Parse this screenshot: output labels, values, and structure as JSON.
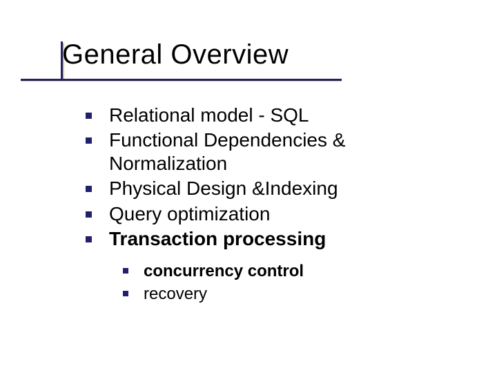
{
  "title": "General Overview",
  "bullets": {
    "level1": [
      {
        "text": "Relational model - SQL",
        "bold": false
      },
      {
        "text": "Functional Dependencies & Normalization",
        "bold": false
      },
      {
        "text": "Physical Design &Indexing",
        "bold": false
      },
      {
        "text": "Query optimization",
        "bold": false
      },
      {
        "text": "Transaction processing",
        "bold": true
      }
    ],
    "level2": [
      {
        "text": "concurrency control",
        "bold": true
      },
      {
        "text": "recovery",
        "bold": false
      }
    ]
  },
  "colors": {
    "accent": "#221f6c",
    "accent_shadow": "#cfcf66"
  }
}
